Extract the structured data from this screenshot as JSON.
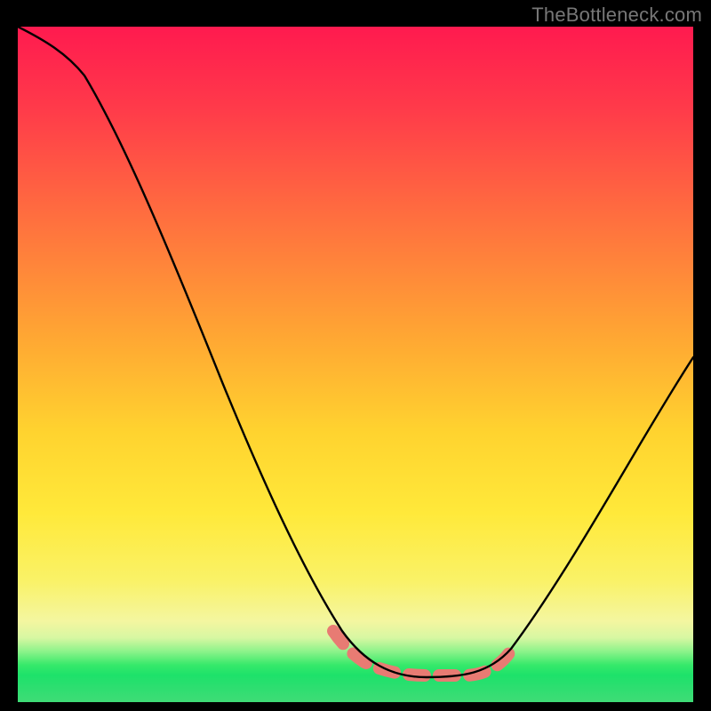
{
  "watermark": "TheBottleneck.com",
  "chart_data": {
    "type": "line",
    "title": "",
    "xlabel": "",
    "ylabel": "",
    "xlim": [
      0,
      100
    ],
    "ylim": [
      0,
      100
    ],
    "x": [
      0,
      5,
      10,
      15,
      20,
      25,
      30,
      35,
      40,
      45,
      48,
      50,
      55,
      60,
      65,
      70,
      75,
      80,
      85,
      90,
      95,
      100
    ],
    "values": [
      100,
      99,
      95,
      87,
      76,
      64,
      52,
      40,
      28,
      16,
      10,
      7,
      4.5,
      4,
      4,
      5,
      8,
      15,
      24,
      33,
      42,
      51
    ],
    "highlight_range_x": [
      46,
      72
    ],
    "background_gradient": {
      "top": "#ff1a4f",
      "mid": "#ffe93a",
      "bottom": "#2adf6f"
    },
    "series": [
      {
        "name": "bottleneck-curve",
        "color": "#000000"
      },
      {
        "name": "optimal-zone-dash",
        "color": "#e87b73"
      }
    ]
  }
}
